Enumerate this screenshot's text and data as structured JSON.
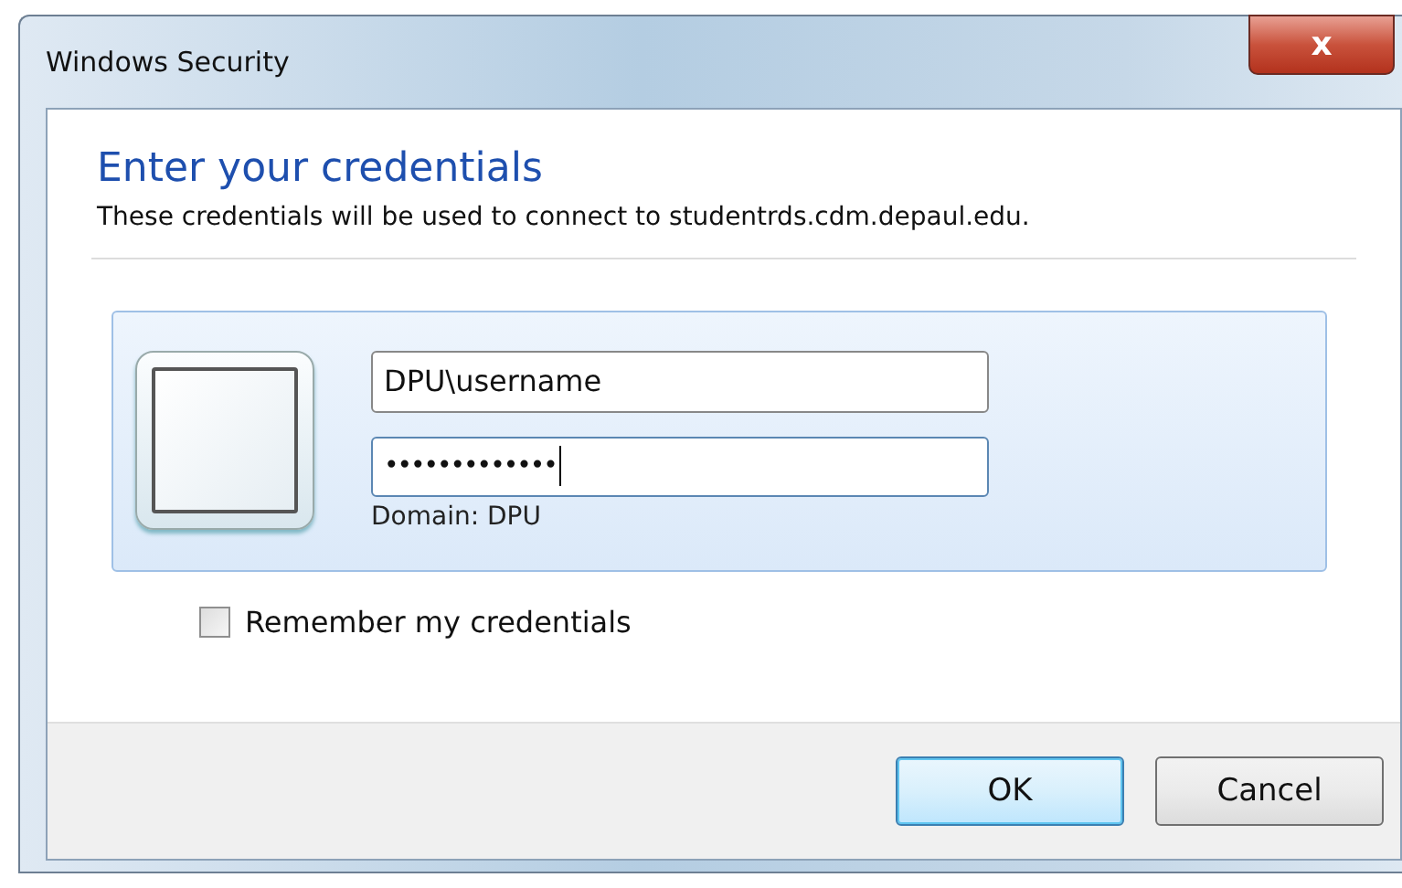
{
  "window": {
    "title": "Windows Security",
    "close": "x"
  },
  "heading": "Enter your credentials",
  "description": "These credentials will be used to connect to studentrds.cdm.depaul.edu.",
  "fields": [
    {
      "kind": "username",
      "value": "DPU\\username",
      "focused": false
    },
    {
      "kind": "password",
      "value": "•••••••••••••",
      "focused": true
    }
  ],
  "domain": "Domain: DPU",
  "remember": {
    "label": "Remember my credentials",
    "checked": false
  },
  "buttons": [
    {
      "label": "OK",
      "selected": true
    },
    {
      "label": "Cancel",
      "selected": false
    }
  ]
}
